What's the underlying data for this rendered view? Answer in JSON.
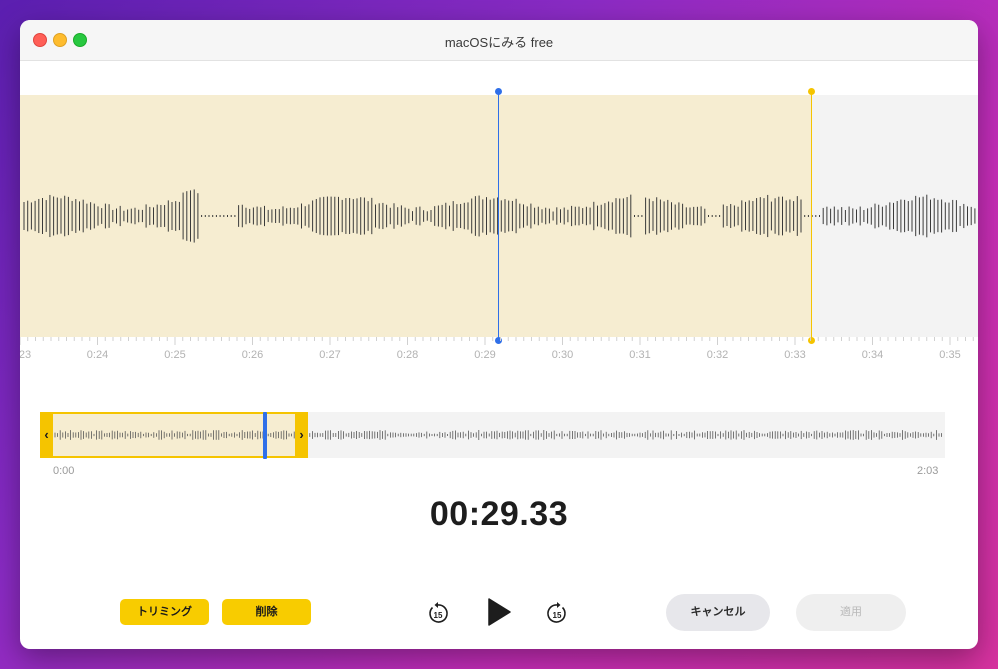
{
  "window": {
    "title": "macOSにみる free"
  },
  "ruler": {
    "labels": [
      "23",
      "0:24",
      "0:25",
      "0:26",
      "0:27",
      "0:28",
      "0:29",
      "0:30",
      "0:31",
      "0:32",
      "0:33",
      "0:34",
      "0:35"
    ]
  },
  "overview": {
    "start_label": "0:00",
    "end_label": "2:03"
  },
  "player": {
    "current_time": "00:29.33"
  },
  "buttons": {
    "trim_label": "トリミング",
    "delete_label": "削除",
    "cancel_label": "キャンセル",
    "apply_label": "適用",
    "skip_back_seconds": "15",
    "skip_forward_seconds": "15"
  },
  "colors": {
    "accent_yellow": "#f8cc00",
    "playhead_blue": "#2f6fe8",
    "selection_bg": "#f6edd1"
  },
  "icons": {
    "skip_back": "gobackward-15-icon",
    "play": "play-icon",
    "skip_forward": "goforward-15-icon"
  }
}
